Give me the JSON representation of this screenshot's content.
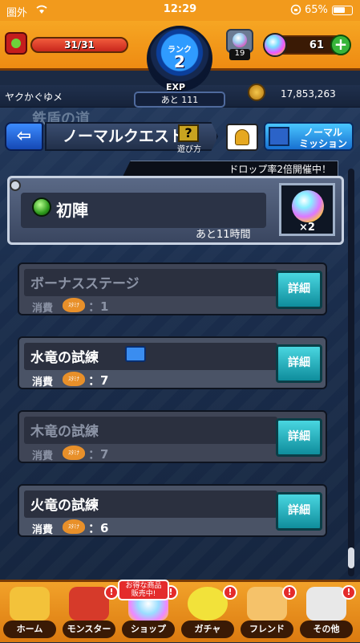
{
  "status_bar": {
    "carrier": "圏外",
    "time": "12:29",
    "battery_pct": "65%"
  },
  "hud": {
    "stamina": "31/31",
    "rank_label": "ランク",
    "rank": "2",
    "exp_label": "EXP",
    "exp_remaining": "あと 111",
    "gem_count": "19",
    "orbs": "61",
    "player_name": "ヤクかぐゆメ",
    "coins": "17,853,263"
  },
  "nav": {
    "title": "ノーマルクエスト",
    "help_label": "遊び方",
    "mission_line1": "ノーマル",
    "mission_line2": "ミッション"
  },
  "background_text": "鉄盾の道",
  "drop_banner": "ドロップ率2倍開催中！",
  "featured": {
    "title": "初陣",
    "remaining": "あと11時間",
    "multiplier": "×2"
  },
  "quests": [
    {
      "title": "ボーナスステージ",
      "cost_label": "消費",
      "stamina_icon": "ｽﾀﾐﾅ",
      "cost": "：1",
      "detail": "詳細",
      "locked": true
    },
    {
      "title": "水竜の試練",
      "cost_label": "消費",
      "stamina_icon": "ｽﾀﾐﾅ",
      "cost": "：7",
      "detail": "詳細",
      "locked": false
    },
    {
      "title": "木竜の試練",
      "cost_label": "消費",
      "stamina_icon": "ｽﾀﾐﾅ",
      "cost": "：7",
      "detail": "詳細",
      "locked": true
    },
    {
      "title": "火竜の試練",
      "cost_label": "消費",
      "stamina_icon": "ｽﾀﾐﾅ",
      "cost": "：6",
      "detail": "詳細",
      "locked": false
    }
  ],
  "bottom_nav": {
    "sale_tag_line1": "お得な商品",
    "sale_tag_line2": "販売中!",
    "items": [
      {
        "label": "ホーム",
        "alert": ""
      },
      {
        "label": "モンスター",
        "alert": "!"
      },
      {
        "label": "ショップ",
        "alert": "!"
      },
      {
        "label": "ガチャ",
        "alert": "!"
      },
      {
        "label": "フレンド",
        "alert": "!"
      },
      {
        "label": "その他",
        "alert": "!"
      }
    ]
  }
}
